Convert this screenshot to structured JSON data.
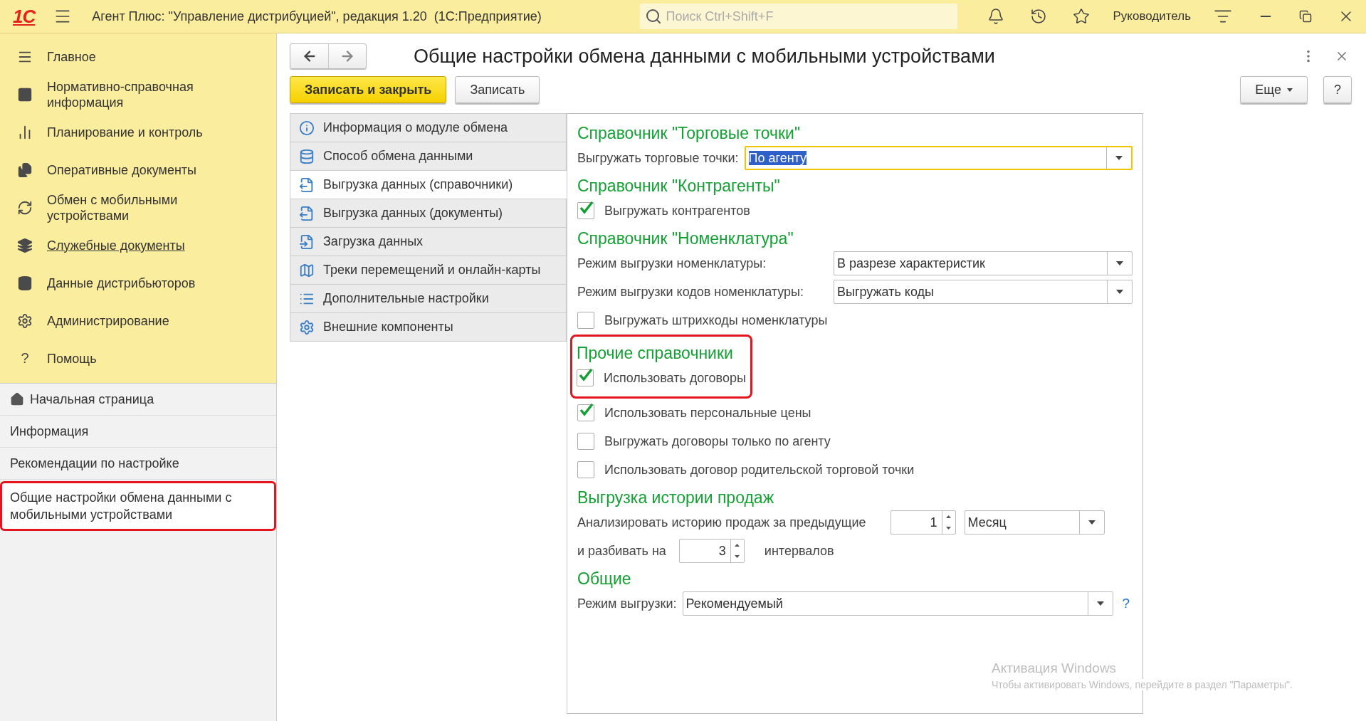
{
  "window": {
    "logo": "1С",
    "title": "Агент Плюс: \"Управление дистрибуцией\", редакция 1.20  (1С:Предприятие)",
    "search": {
      "placeholder": "Поиск Ctrl+Shift+F"
    },
    "user": "Руководитель"
  },
  "sidebar": {
    "sections": [
      {
        "label": "Главное",
        "underlined": false
      },
      {
        "label": "Нормативно-справочная информация",
        "underlined": false
      },
      {
        "label": "Планирование и контроль",
        "underlined": false
      },
      {
        "label": "Оперативные документы",
        "underlined": false
      },
      {
        "label": "Обмен с мобильными устройствами",
        "underlined": false
      },
      {
        "label": "Служебные документы",
        "underlined": true
      },
      {
        "label": "Данные дистрибьюторов",
        "underlined": false
      },
      {
        "label": "Администрирование",
        "underlined": false
      },
      {
        "label": "Помощь",
        "glyph": "?",
        "underlined": false
      }
    ],
    "pages": [
      {
        "label": "Начальная страница",
        "kind": "home",
        "selected": false,
        "highlighted": false
      },
      {
        "label": "Информация",
        "kind": "plain",
        "selected": false,
        "highlighted": false
      },
      {
        "label": "Рекомендации по настройке",
        "kind": "plain",
        "selected": false,
        "highlighted": false
      },
      {
        "label": "Общие настройки обмена данными с мобильными устройствами",
        "kind": "plain",
        "selected": true,
        "highlighted": true
      }
    ]
  },
  "form": {
    "title": "Общие настройки обмена данными с мобильными устройствами",
    "buttons": [
      {
        "label": "Записать и закрыть",
        "kind": "primary"
      },
      {
        "label": "Записать",
        "kind": "normal"
      }
    ],
    "more_button": "Еще",
    "help_button": "?",
    "nav": [
      {
        "label": "Информация о модуле обмена",
        "selected": false
      },
      {
        "label": "Способ обмена данными",
        "selected": false
      },
      {
        "label": "Выгрузка данных (справочники)",
        "selected": true
      },
      {
        "label": "Выгрузка данных (документы)",
        "selected": false
      },
      {
        "label": "Загрузка данных",
        "selected": false
      },
      {
        "label": "Треки перемещений и онлайн-карты",
        "selected": false
      },
      {
        "label": "Дополнительные настройки",
        "selected": false
      },
      {
        "label": "Внешние компоненты",
        "selected": false
      }
    ],
    "groups": [
      {
        "title": "Справочник \"Торговые точки\"",
        "highlighted": false,
        "rows": [
          {
            "kind": "select",
            "label": "Выгружать торговые точки:",
            "value": "По агенту",
            "focused": true,
            "text_selected": true,
            "aligned": false
          }
        ]
      },
      {
        "title": "Справочник \"Контрагенты\"",
        "highlighted": false,
        "rows": [
          {
            "kind": "checkbox",
            "label": "Выгружать контрагентов",
            "checked": true
          }
        ]
      },
      {
        "title": "Справочник \"Номенклатура\"",
        "highlighted": false,
        "rows": [
          {
            "kind": "select",
            "label": "Режим выгрузки номенклатуры:",
            "value": "В разрезе характеристик",
            "focused": false,
            "text_selected": false,
            "aligned": true
          },
          {
            "kind": "select",
            "label": "Режим выгрузки кодов номенклатуры:",
            "value": "Выгружать коды",
            "focused": false,
            "text_selected": false,
            "aligned": true
          },
          {
            "kind": "checkbox",
            "label": "Выгружать штрихкоды номенклатуры",
            "checked": false
          }
        ]
      },
      {
        "title": "Прочие справочники",
        "highlighted": true,
        "rows": [
          {
            "kind": "checkbox",
            "label": "Использовать договоры",
            "checked": true
          }
        ]
      },
      {
        "highlighted": false,
        "rows": [
          {
            "kind": "checkbox",
            "label": "Использовать персональные цены",
            "checked": true
          },
          {
            "kind": "checkbox",
            "label": "Выгружать договоры только по агенту",
            "checked": false
          },
          {
            "kind": "checkbox",
            "label": "Использовать договор родительской торговой точки",
            "checked": false
          }
        ]
      },
      {
        "title": "Выгрузка истории продаж",
        "highlighted": false,
        "rows": [
          {
            "kind": "period",
            "label": "Анализировать историю продаж за предыдущие",
            "number": "1",
            "unit": "Месяц"
          },
          {
            "kind": "split",
            "label": "и разбивать на",
            "number": "3",
            "suffix": "интервалов"
          }
        ]
      },
      {
        "title": "Общие",
        "highlighted": false,
        "rows": [
          {
            "kind": "select",
            "label": "Режим выгрузки:",
            "value": "Рекомендуемый",
            "focused": false,
            "text_selected": false,
            "aligned": false,
            "help": "?"
          }
        ]
      }
    ]
  },
  "os_notice": {
    "title": "Активация Windows",
    "text": "Чтобы активировать Windows, перейдите в раздел \"Параметры\"."
  }
}
